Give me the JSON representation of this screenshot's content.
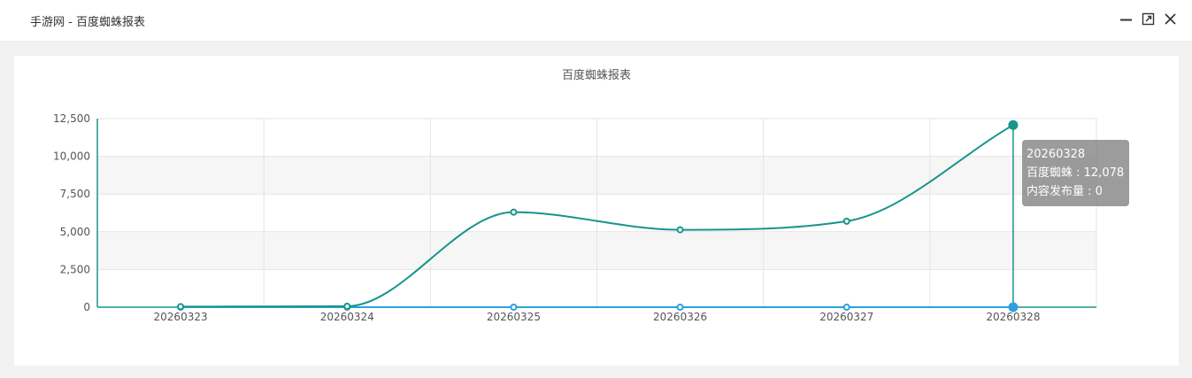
{
  "window": {
    "title": "手游网 - 百度蜘蛛报表",
    "buttons": {
      "minimize": "minimize-icon",
      "maximize": "maximize-icon",
      "close": "close-icon"
    }
  },
  "chart_data": {
    "type": "line",
    "title": "百度蜘蛛报表",
    "xlabel": "",
    "ylabel": "",
    "categories": [
      "20260323",
      "20260324",
      "20260325",
      "20260326",
      "20260327",
      "20260328"
    ],
    "ylim": [
      0,
      12500
    ],
    "yticks": [
      "0",
      "2,500",
      "5,000",
      "7,500",
      "10,000",
      "12,500"
    ],
    "grid": true,
    "series": [
      {
        "name": "百度蜘蛛",
        "color": "#16958a",
        "values": [
          40,
          60,
          6300,
          5130,
          5700,
          12078
        ]
      },
      {
        "name": "内容发布量",
        "color": "#2ea0e0",
        "values": [
          0,
          0,
          0,
          0,
          0,
          0
        ]
      }
    ],
    "colors": {
      "band": "#f6f6f6",
      "grid": "#e4e4e4",
      "axis": "#16958a",
      "text": "#555555"
    }
  },
  "tooltip": {
    "header": "20260328",
    "rows": [
      "百度蜘蛛 : 12,078",
      "内容发布量 : 0"
    ]
  }
}
